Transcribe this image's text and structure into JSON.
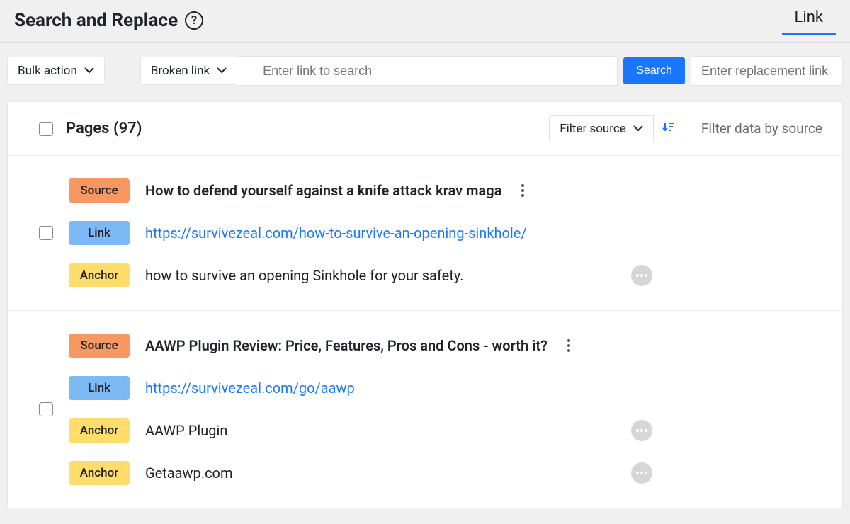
{
  "header": {
    "title": "Search and Replace",
    "help_glyph": "?",
    "tab_label": "Link"
  },
  "controls": {
    "bulk_label": "Bulk action",
    "filter_label": "Broken link",
    "search_placeholder": "Enter link to search",
    "search_button": "Search",
    "replace_placeholder": "Enter replacement link"
  },
  "panel": {
    "title": "Pages (97)",
    "filter_source_label": "Filter source",
    "filter_text": "Filter data by source"
  },
  "labels": {
    "source": "Source",
    "link": "Link",
    "anchor": "Anchor"
  },
  "rows": [
    {
      "source": "How to defend yourself against a knife attack krav maga",
      "link": "https://survivezeal.com/how-to-survive-an-opening-sinkhole/",
      "anchors": [
        "how to survive an opening Sinkhole for your safety."
      ]
    },
    {
      "source": "AAWP Plugin Review: Price, Features, Pros and Cons - worth it?",
      "link": "https://survivezeal.com/go/aawp",
      "anchors": [
        "AAWP Plugin",
        "Getaawp.com"
      ]
    }
  ]
}
